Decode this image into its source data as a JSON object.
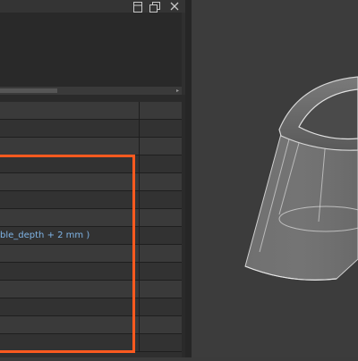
{
  "panel": {
    "header_icons": [
      "window-restore-icon",
      "pop-out-icon",
      "close-icon"
    ],
    "rows": [
      {
        "text": ""
      },
      {
        "text": ""
      },
      {
        "text": ""
      },
      {
        "text": ""
      },
      {
        "text": ""
      },
      {
        "text": ""
      },
      {
        "text": ""
      },
      {
        "text": "ble_depth + 2 mm )"
      },
      {
        "text": ""
      },
      {
        "text": ""
      },
      {
        "text": ""
      },
      {
        "text": ""
      },
      {
        "text": ""
      },
      {
        "text": ""
      }
    ]
  },
  "colors": {
    "highlight": "#ff5a1f",
    "expression_text": "#7fb4e6",
    "viewport_background": "#3c3c3c"
  }
}
